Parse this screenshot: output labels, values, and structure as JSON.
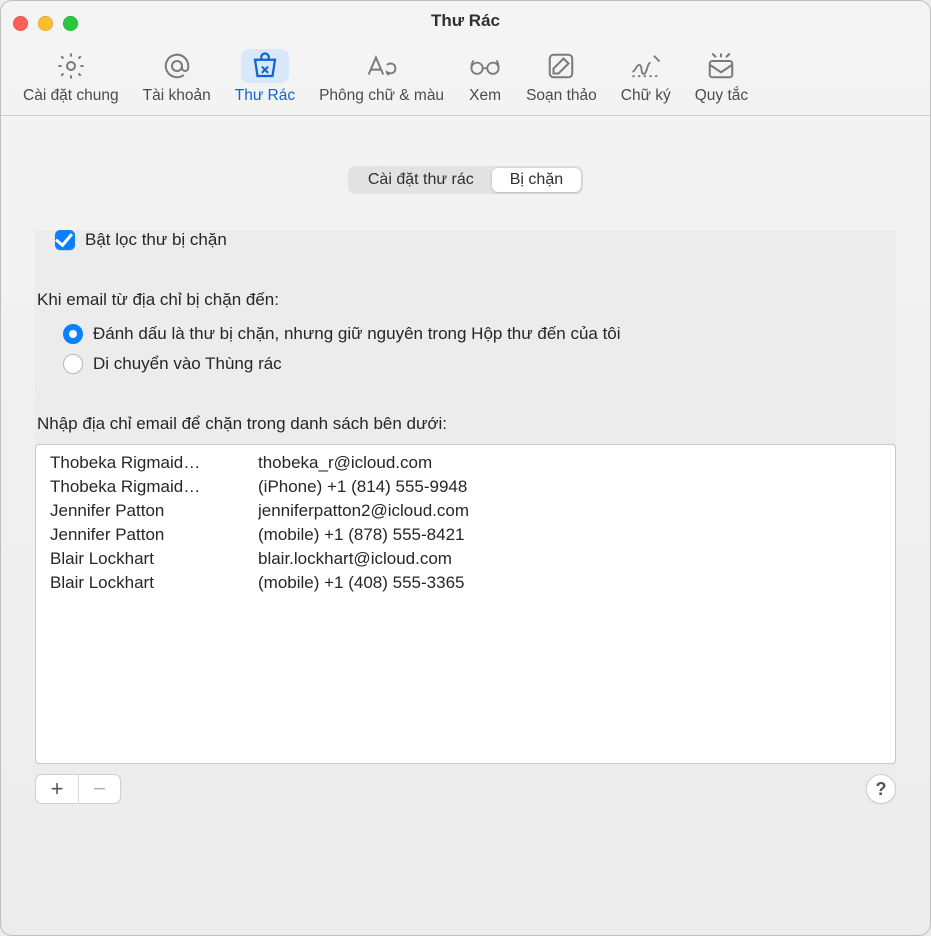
{
  "window": {
    "title": "Thư Rác"
  },
  "toolbar": {
    "items": [
      {
        "id": "general",
        "label": "Cài đặt chung"
      },
      {
        "id": "accounts",
        "label": "Tài khoản"
      },
      {
        "id": "junk",
        "label": "Thư Rác",
        "active": true
      },
      {
        "id": "fonts",
        "label": "Phông chữ & màu"
      },
      {
        "id": "viewing",
        "label": "Xem"
      },
      {
        "id": "compose",
        "label": "Soạn thảo"
      },
      {
        "id": "sign",
        "label": "Chữ ký"
      },
      {
        "id": "rules",
        "label": "Quy tắc"
      }
    ]
  },
  "segmented": {
    "options": [
      {
        "label": "Cài đặt thư rác"
      },
      {
        "label": "Bị chặn",
        "active": true
      }
    ]
  },
  "enable_checkbox_label": "Bật lọc thư bị chặn",
  "when_blocked_header": "Khi email từ địa chỉ bị chặn đến:",
  "radio": {
    "mark_keep": "Đánh dấu là thư bị chặn, nhưng giữ nguyên trong Hộp thư đến của tôi",
    "move_trash": "Di chuyển vào Thùng rác"
  },
  "list_header": "Nhập địa chỉ email để chặn trong danh sách bên dưới:",
  "blocked": [
    {
      "name": "Thobeka Rigmaid…",
      "value": "thobeka_r@icloud.com"
    },
    {
      "name": "Thobeka Rigmaid…",
      "value": "(iPhone) +1 (814) 555-9948"
    },
    {
      "name": "Jennifer Patton",
      "value": "jenniferpatton2@icloud.com"
    },
    {
      "name": "Jennifer Patton",
      "value": "(mobile) +1 (878) 555-8421"
    },
    {
      "name": "Blair Lockhart",
      "value": "blair.lockhart@icloud.com"
    },
    {
      "name": "Blair Lockhart",
      "value": "(mobile) +1 (408) 555-3365"
    }
  ],
  "buttons": {
    "add": "+",
    "remove": "−",
    "help": "?"
  }
}
